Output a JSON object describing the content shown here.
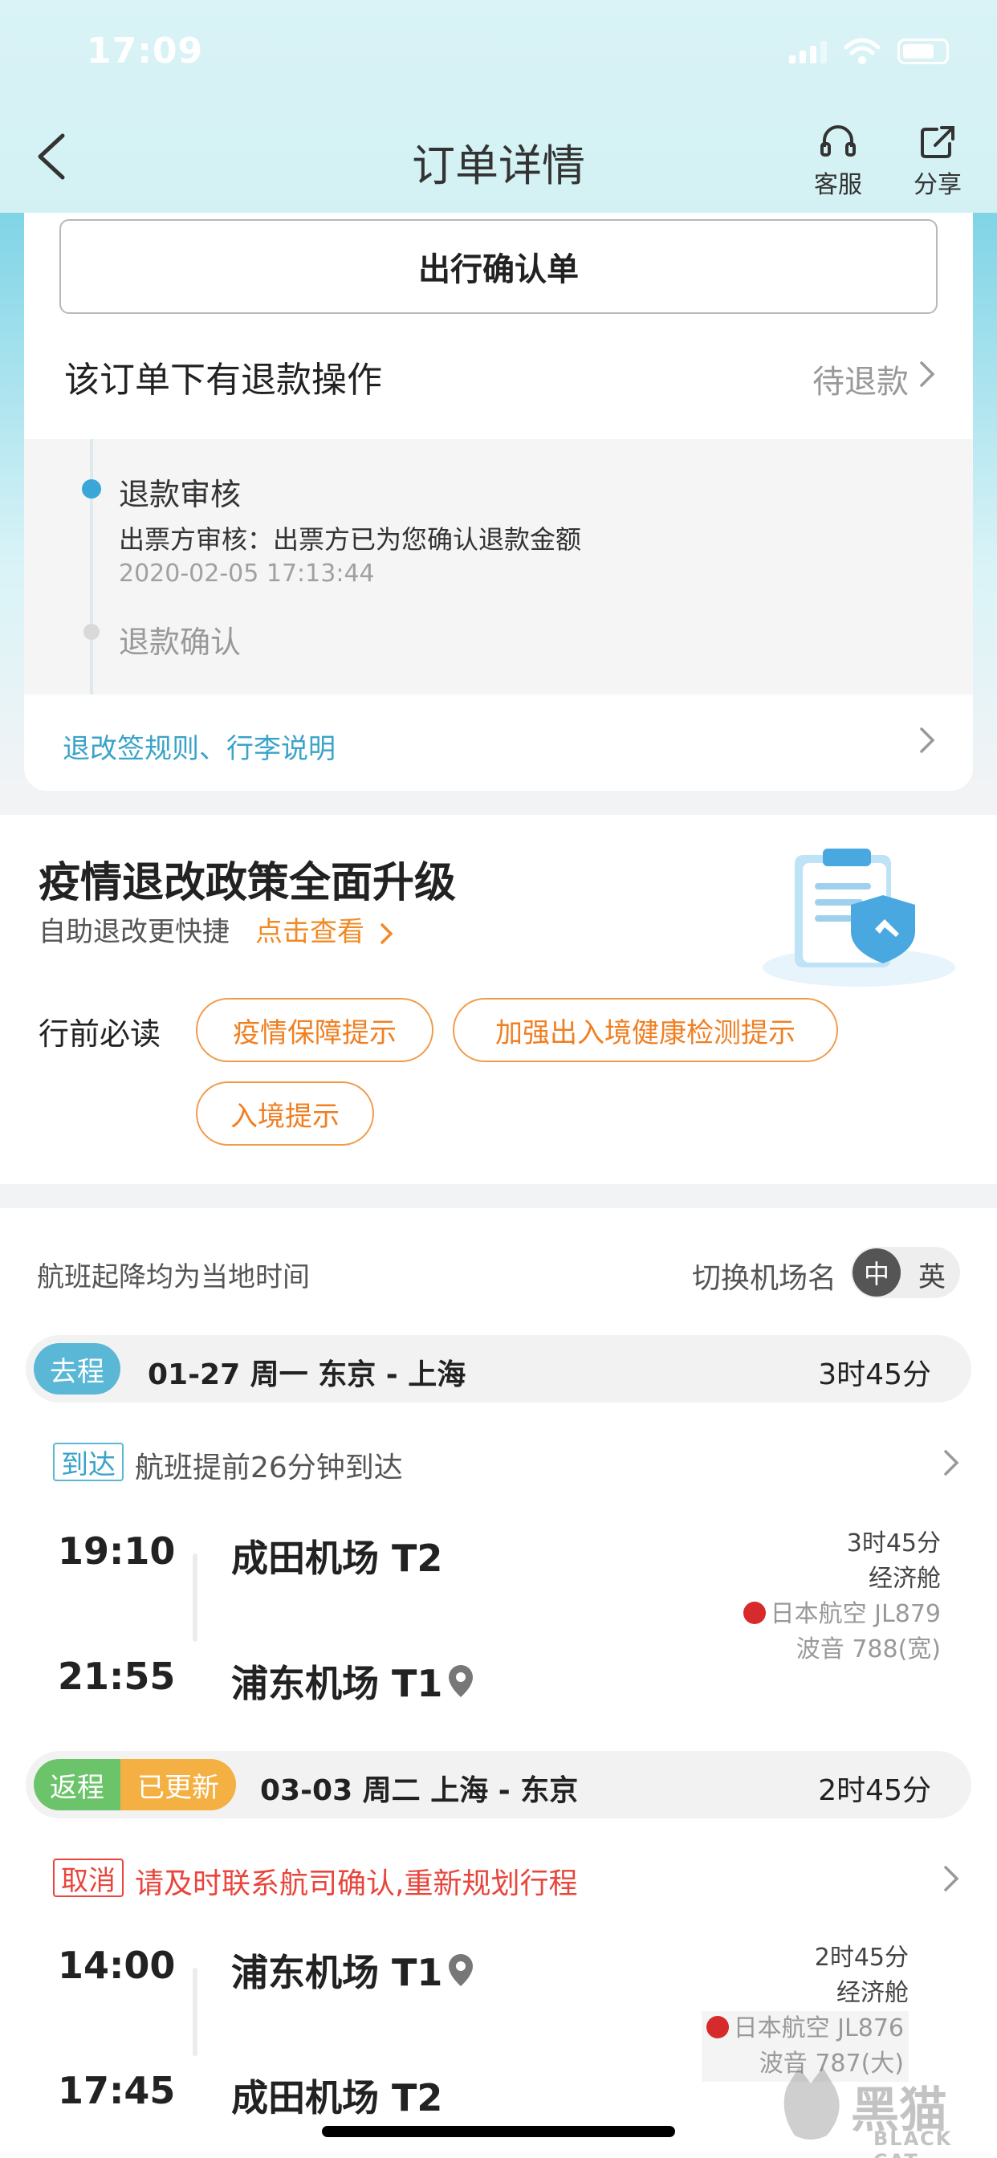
{
  "status": {
    "time": "17:09"
  },
  "nav": {
    "title": "订单详情",
    "service_label": "客服",
    "share_label": "分享"
  },
  "order": {
    "confirm_button": "出行确认单",
    "refund_title": "该订单下有退款操作",
    "refund_status": "待退款",
    "timeline": [
      {
        "step": "退款审核",
        "detail": "出票方审核：出票方已为您确认退款金额",
        "time": "2020-02-05 17:13:44"
      },
      {
        "step": "退款确认"
      }
    ],
    "rules_link": "退改签规则、行李说明"
  },
  "policy": {
    "title": "疫情退改政策全面升级",
    "subtitle": "自助退改更快捷",
    "link": "点击查看",
    "must_read": "行前必读",
    "pills": [
      "疫情保障提示",
      "加强出入境健康检测提示",
      "入境提示"
    ]
  },
  "flights": {
    "local_note": "航班起降均为当地时间",
    "switch_label": "切换机场名",
    "lang_zh": "中",
    "lang_en": "英",
    "outbound": {
      "tag": "去程",
      "route": "01-27  周一  东京 - 上海",
      "duration": "3时45分",
      "note_tag": "到达",
      "note_text": "航班提前26分钟到达",
      "dep_time": "19:10",
      "dep_airport": "成田机场 T2",
      "arr_time": "21:55",
      "arr_airport": "浦东机场 T1",
      "info_duration": "3时45分",
      "cabin": "经济舱",
      "airline": "日本航空 JL879",
      "aircraft": "波音 788(宽)"
    },
    "return": {
      "tag": "返程",
      "updated_tag": "已更新",
      "route": "03-03  周二  上海 - 东京",
      "duration": "2时45分",
      "note_tag": "取消",
      "note_text": "请及时联系航司确认,重新规划行程",
      "dep_time": "14:00",
      "dep_airport": "浦东机场 T1",
      "arr_time": "17:45",
      "arr_airport": "成田机场 T2",
      "info_duration": "2时45分",
      "cabin": "经济舱",
      "airline": "日本航空 JL876",
      "aircraft": "波音 787(大)"
    }
  },
  "watermark": {
    "text": "黑猫",
    "sub": "BLACK CAT"
  },
  "colors": {
    "accent_blue": "#3aa3c9",
    "accent_orange": "#f07f22",
    "cancel_red": "#e8453c"
  }
}
